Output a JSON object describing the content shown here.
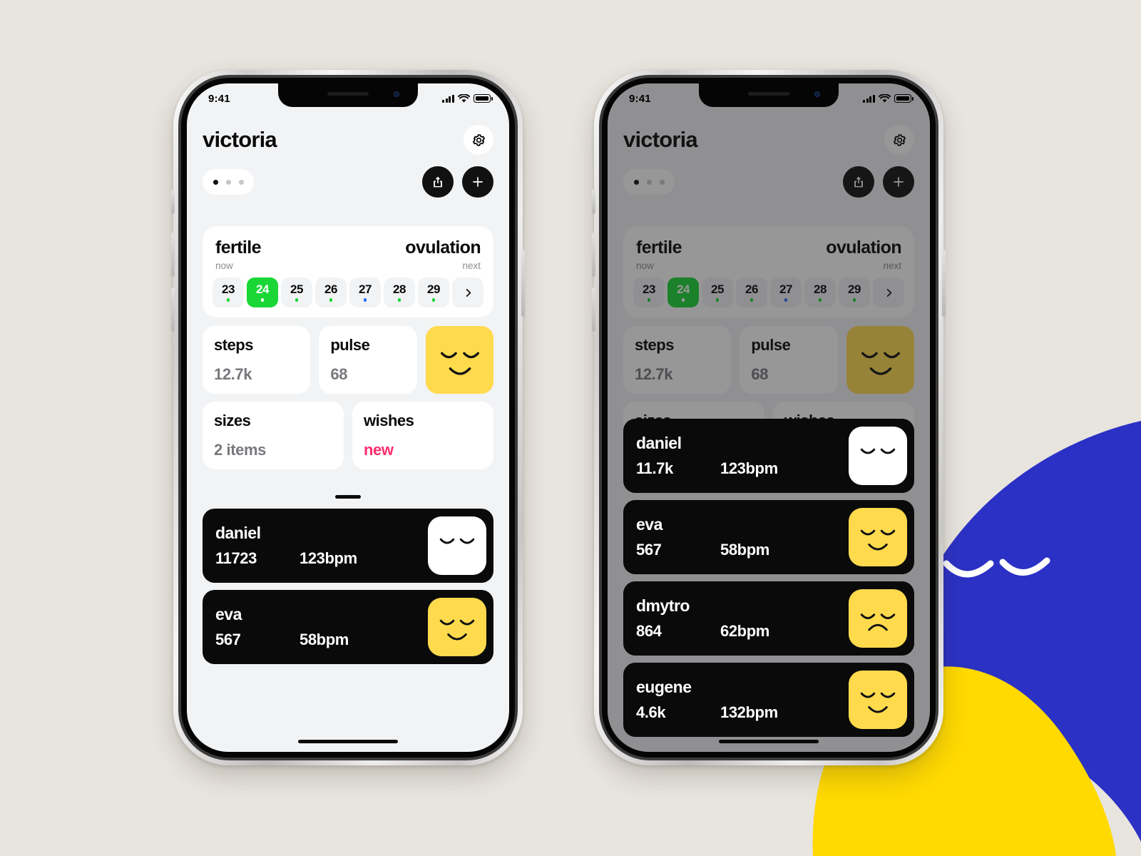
{
  "page": {
    "background_color": "#e8e4de",
    "accent_green": "#1ad735",
    "accent_pink": "#ff2d6f",
    "accent_yellow": "#ffda4d",
    "accent_blue": "#2b31c4"
  },
  "status_bar": {
    "time": "9:41",
    "signal_icon": "cellular-bars-icon",
    "wifi_icon": "wifi-icon",
    "battery_icon": "battery-full-icon"
  },
  "header": {
    "title": "victoria",
    "settings_icon": "gear-icon",
    "share_icon": "share-icon",
    "add_icon": "plus-icon"
  },
  "pager": {
    "total": 3,
    "active_index": 0
  },
  "cycle_card": {
    "phase_now_label": "fertile",
    "phase_now_caption": "now",
    "phase_next_label": "ovulation",
    "phase_next_caption": "next",
    "next_icon": "chevron-right-icon",
    "days": [
      {
        "num": "23",
        "dot": "#1ad735",
        "active": false
      },
      {
        "num": "24",
        "dot": "#ffffff",
        "active": true
      },
      {
        "num": "25",
        "dot": "#1ad735",
        "active": false
      },
      {
        "num": "26",
        "dot": "#1ad735",
        "active": false
      },
      {
        "num": "27",
        "dot": "#2b6ef5",
        "active": false
      },
      {
        "num": "28",
        "dot": "#1ad735",
        "active": false
      },
      {
        "num": "29",
        "dot": "#1ad735",
        "active": false
      }
    ]
  },
  "metrics": {
    "steps": {
      "label": "steps",
      "value": "12.7k"
    },
    "pulse": {
      "label": "pulse",
      "value": "68"
    },
    "sizes": {
      "label": "sizes",
      "value": "2 items"
    },
    "wishes": {
      "label": "wishes",
      "value": "new"
    },
    "mood_tile_icon": "smiling-face-icon"
  },
  "friends_left": [
    {
      "name": "daniel",
      "steps": "11723",
      "pulse": "123bpm",
      "avatar_icon": "closed-eyes-face-icon",
      "avatar_color": "#ffffff",
      "mood": "neutral"
    },
    {
      "name": "eva",
      "steps": "567",
      "pulse": "58bpm",
      "avatar_icon": "smiling-face-icon",
      "avatar_color": "#ffda4d",
      "mood": "happy"
    }
  ],
  "friends_right": [
    {
      "name": "daniel",
      "steps": "11.7k",
      "pulse": "123bpm",
      "avatar_icon": "closed-eyes-face-icon",
      "avatar_color": "#ffffff",
      "mood": "neutral"
    },
    {
      "name": "eva",
      "steps": "567",
      "pulse": "58bpm",
      "avatar_icon": "smiling-face-icon",
      "avatar_color": "#ffda4d",
      "mood": "happy"
    },
    {
      "name": "dmytro",
      "steps": "864",
      "pulse": "62bpm",
      "avatar_icon": "sad-face-icon",
      "avatar_color": "#ffda4d",
      "mood": "sad"
    },
    {
      "name": "eugene",
      "steps": "4.6k",
      "pulse": "132bpm",
      "avatar_icon": "smiling-face-icon",
      "avatar_color": "#ffda4d",
      "mood": "happy"
    }
  ],
  "decor": {
    "blue_blob_icon": "blue-sleeping-blob-icon",
    "yellow_blob_icon": "yellow-sleeping-blob-icon"
  }
}
